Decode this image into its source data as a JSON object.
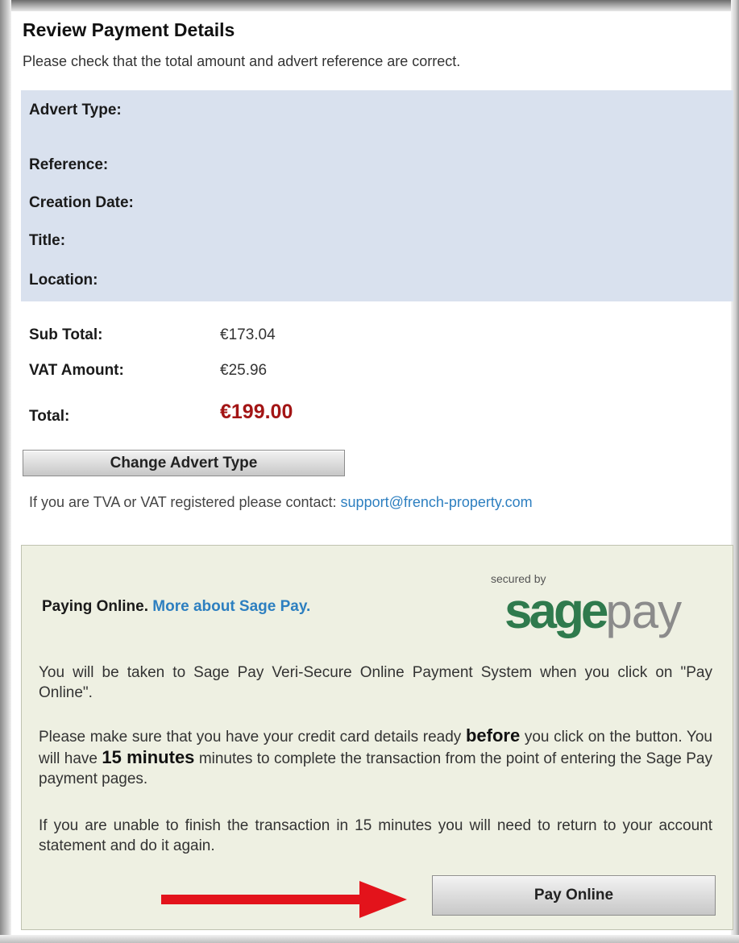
{
  "page": {
    "title": "Review Payment Details",
    "intro": "Please check that the total amount and advert reference are correct."
  },
  "details": {
    "labels": [
      "Advert Type:",
      "Reference:",
      "Creation Date:",
      "Title:",
      "Location:"
    ]
  },
  "summary": {
    "subtotal_label": "Sub Total:",
    "subtotal_value": "€173.04",
    "vat_label": "VAT Amount:",
    "vat_value": "€25.96",
    "total_label": "Total:",
    "total_value": "€199.00"
  },
  "actions": {
    "change_advert_type": "Change Advert Type",
    "pay_online": "Pay Online"
  },
  "vat_note": {
    "text": "If you are TVA or VAT registered please contact: ",
    "email": "support@french-property.com"
  },
  "payment": {
    "paying_online": "Paying Online.",
    "more_about": "More about Sage Pay.",
    "secured_by": "secured by",
    "logo_sage": "sage",
    "logo_pay": "pay",
    "p1": "You will be taken to Sage Pay Veri-Secure Online Payment System when you click on \"Pay Online\".",
    "p2_a": "Please make sure that you have your credit card details ready ",
    "p2_b": "before",
    "p2_c": " you click on the button. You will have ",
    "p2_d": "15 minutes",
    "p2_e": " minutes to complete the transaction from the point of entering the Sage Pay payment pages.",
    "p3": "If you are unable to finish the transaction in 15 minutes you will need to return to your account statement and do it again."
  },
  "colors": {
    "details_bg": "#d9e1ee",
    "panel_bg": "#eef0e2",
    "total_red": "#a31515",
    "link_blue": "#2d7fc0",
    "sage_green": "#2f7a4d",
    "arrow_red": "#e3131b"
  }
}
